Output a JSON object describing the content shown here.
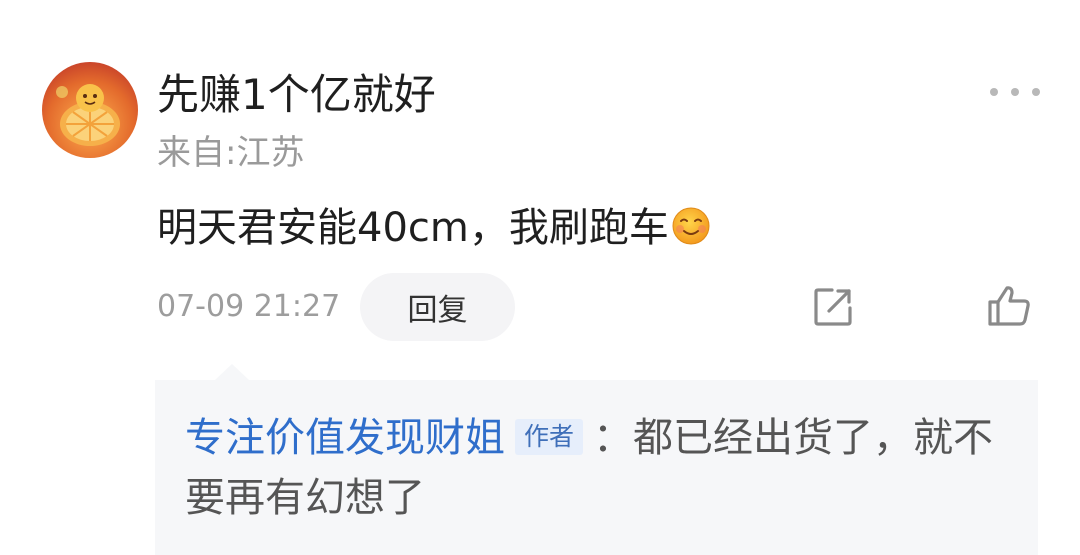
{
  "comment": {
    "username": "先赚1个亿就好",
    "location": "来自:江苏",
    "text": "明天君安能40cm，我刷跑车",
    "emoji": "smile-emoji",
    "timestamp": "07-09 21:27",
    "reply_label": "回复",
    "icons": [
      "more-icon",
      "share-icon",
      "thumbs-up-icon"
    ]
  },
  "reply": {
    "author": "专注价值发现财姐",
    "author_tag": "作者",
    "separator": "：",
    "text": "都已经出货了，就不要再有幻想了"
  },
  "colors": {
    "author_blue": "#2f6ecb",
    "tag_bg": "#e6eefb",
    "reply_bg": "#f6f7f9",
    "muted_gray": "#9a9a9a"
  }
}
